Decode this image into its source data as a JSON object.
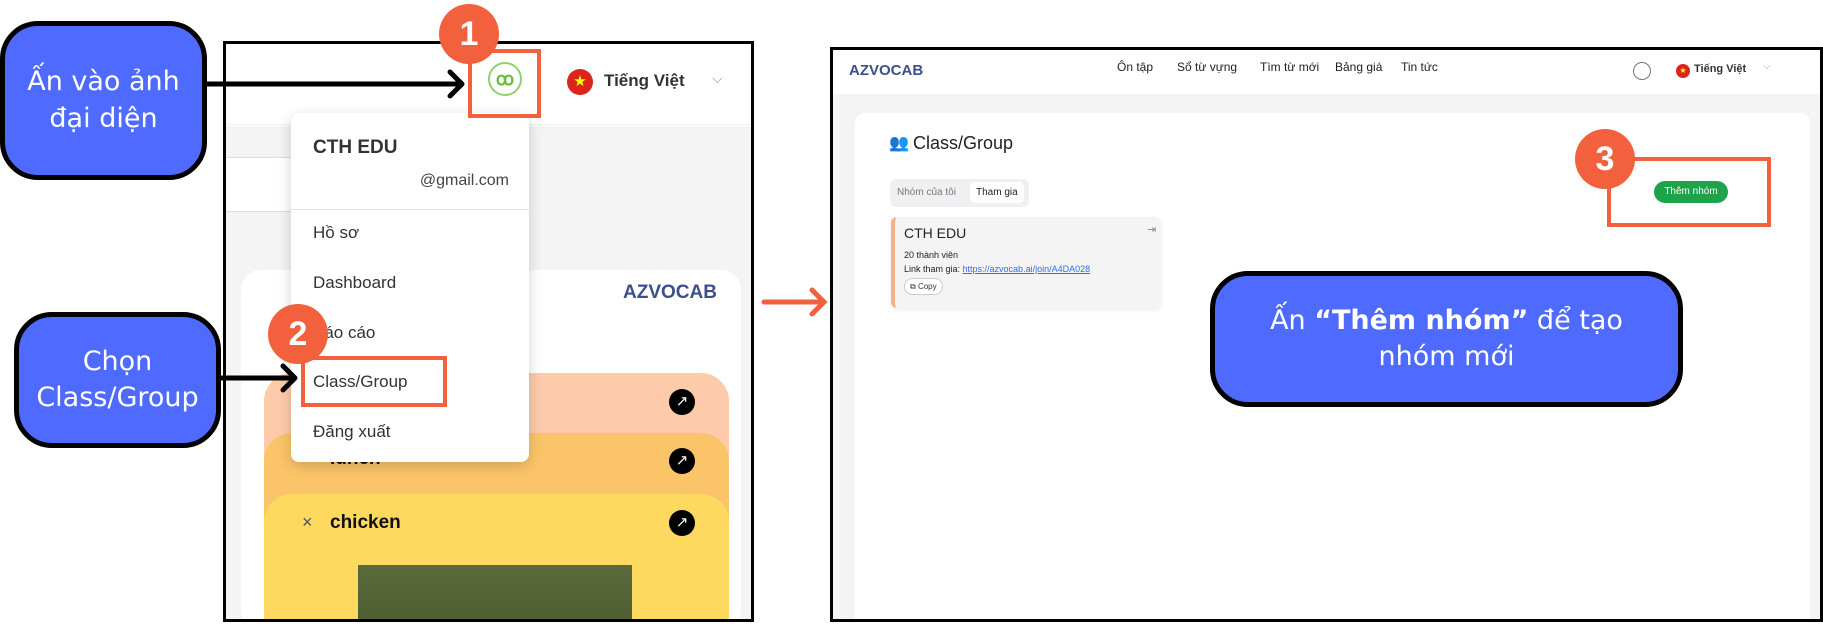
{
  "callouts": {
    "avatar": "Ấn vào ảnh đại diện",
    "class_group": "Chọn Class/Group",
    "add_group_prefix": "Ấn ",
    "add_group_bold": "“Thêm nhóm”",
    "add_group_suffix": " để tạo nhóm mới"
  },
  "steps": [
    "1",
    "2",
    "3"
  ],
  "colors": {
    "callout": "#4f6bff",
    "highlight": "#f2603d",
    "add_button": "#1fa34a"
  },
  "left": {
    "language": "Tiếng Việt",
    "menu": {
      "name": "CTH EDU",
      "email": "@gmail.com",
      "items": [
        "Hồ sơ",
        "Dashboard",
        "Báo cáo",
        "Class/Group",
        "Đăng xuất"
      ]
    },
    "logo": "AZVOCAB",
    "cards": [
      "lunch",
      "chicken"
    ]
  },
  "right": {
    "logo": "AZVOCAB",
    "nav": [
      "Ôn tập",
      "Sổ từ vựng",
      "Tìm từ mới",
      "Bảng giá",
      "Tin tức"
    ],
    "language": "Tiếng Việt",
    "title": "Class/Group",
    "tabs": [
      "Nhóm của tôi",
      "Tham gia"
    ],
    "add_button": "Thêm nhóm",
    "group": {
      "name": "CTH EDU",
      "members": "20 thành viên",
      "link_label": "Link tham gia: ",
      "link": "https://azvocab.ai/join/A4DA028",
      "copy": "Copy"
    }
  }
}
